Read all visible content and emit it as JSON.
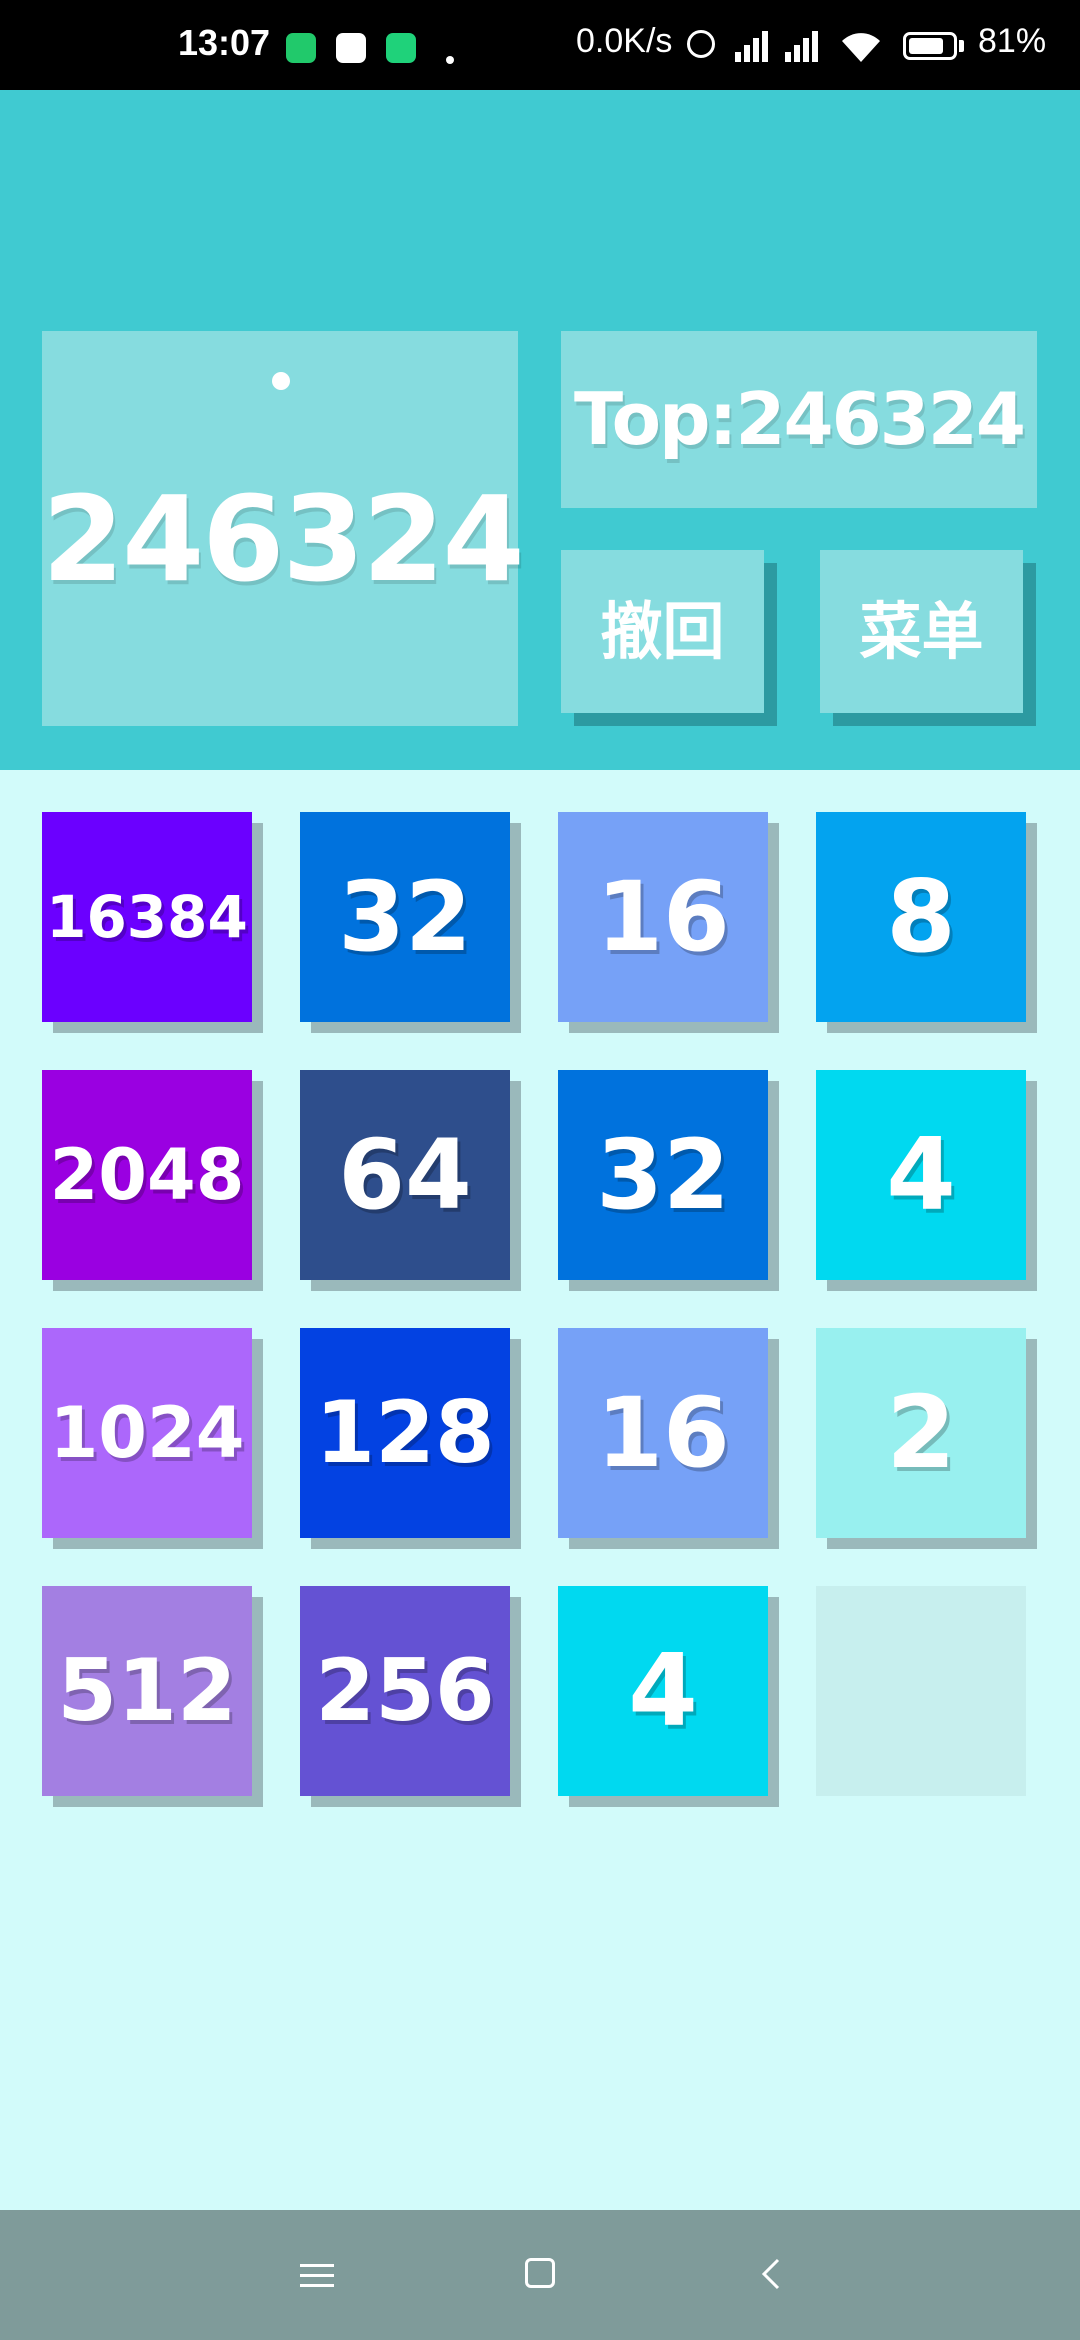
{
  "status_bar": {
    "time": "13:07",
    "net_speed": "0.0K/s",
    "battery_percent": "81%",
    "battery_level": 0.81,
    "app_icons": [
      {
        "name": "shield-app-icon",
        "color": "#21c96b"
      },
      {
        "name": "chat-app-icon",
        "color": "#ffffff"
      },
      {
        "name": "green-app-icon",
        "color": "#1fd27a"
      }
    ]
  },
  "header": {
    "score": "246324",
    "top_score": "Top:246324",
    "undo_label": "撤回",
    "menu_label": "菜单"
  },
  "board": {
    "tiles": [
      {
        "value": "16384",
        "color": "#6b00ff"
      },
      {
        "value": "32",
        "color": "#0072dd"
      },
      {
        "value": "16",
        "color": "#76a1f7"
      },
      {
        "value": "8",
        "color": "#03a3ef"
      },
      {
        "value": "2048",
        "color": "#9a00e1"
      },
      {
        "value": "64",
        "color": "#2e4e8c"
      },
      {
        "value": "32",
        "color": "#0072dd"
      },
      {
        "value": "4",
        "color": "#00d9f0"
      },
      {
        "value": "1024",
        "color": "#ac67fb"
      },
      {
        "value": "128",
        "color": "#0342e2"
      },
      {
        "value": "16",
        "color": "#76a1f7"
      },
      {
        "value": "2",
        "color": "#98f0ef"
      },
      {
        "value": "512",
        "color": "#a37fe2"
      },
      {
        "value": "256",
        "color": "#6452d3"
      },
      {
        "value": "4",
        "color": "#00d9f0"
      },
      {
        "value": "",
        "color": "#c7efee"
      }
    ]
  },
  "colors": {
    "header_bg": "#40cad1",
    "panel_bg": "#86dcdf",
    "board_bg": "#d2fbfa",
    "nav_bg": "#7f9b9a"
  }
}
